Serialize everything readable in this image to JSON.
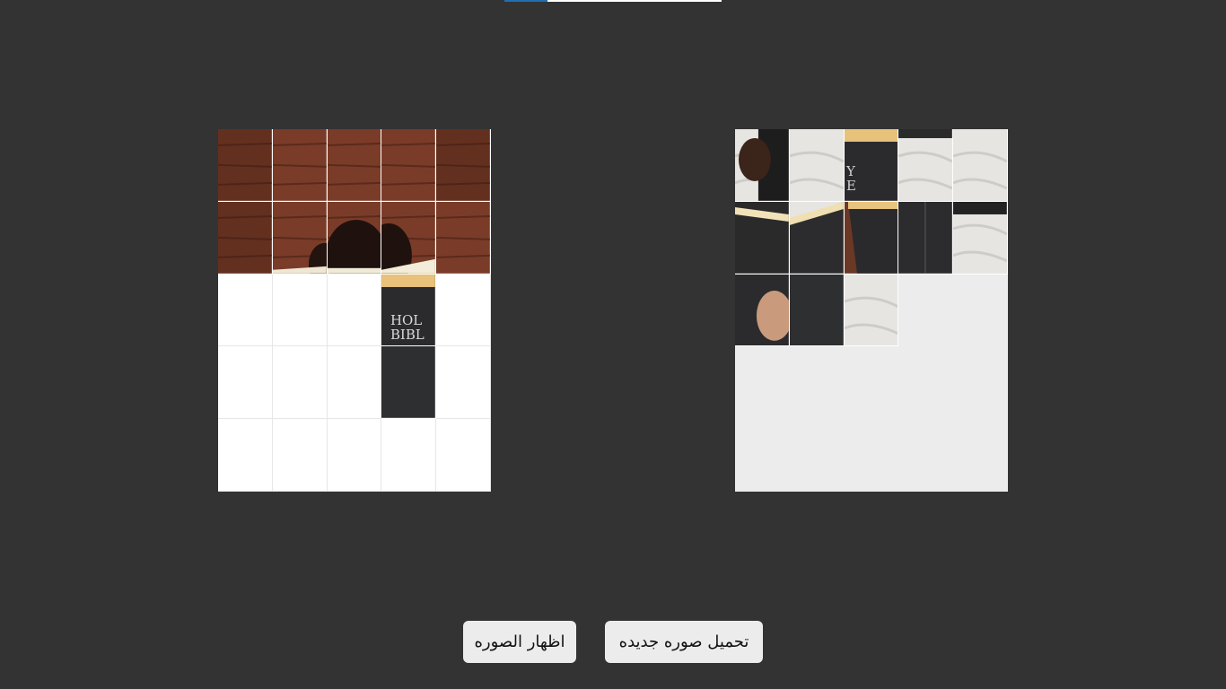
{
  "progress": {
    "value": 0.2
  },
  "puzzle_board": {
    "rows": 5,
    "cols": 5,
    "cells": [
      "wall-dark",
      "wall",
      "wall",
      "wall",
      "wall-dark",
      "wall-dark",
      "wall-head",
      "head",
      "head-page",
      "wall",
      "empty",
      "empty",
      "empty",
      "book-holy",
      "empty",
      "empty",
      "empty",
      "empty",
      "book-black",
      "empty",
      "empty",
      "empty",
      "empty",
      "empty",
      "empty"
    ]
  },
  "pieces_tray": {
    "pieces": [
      "hand-book",
      "cloth",
      "book-text",
      "cloth-dark",
      "cloth",
      "book-pages",
      "book-spine-open",
      "book-edge",
      "book-spine",
      "cloth-book",
      "hand-lower",
      "book-black",
      "cloth"
    ]
  },
  "buttons": {
    "show_image": "اظهار الصوره",
    "load_new_image": "تحميل صوره جديده"
  },
  "tile_text": {
    "holy_line1": "HOL",
    "holy_line2": "BIBL",
    "partial_line1": "Y",
    "partial_line2": "E"
  },
  "colors": {
    "background": "#333333",
    "button_bg": "#ececec",
    "progress_fill": "#1f6fb5",
    "board_bg": "#ffffff",
    "tray_bg": "#ececec"
  }
}
